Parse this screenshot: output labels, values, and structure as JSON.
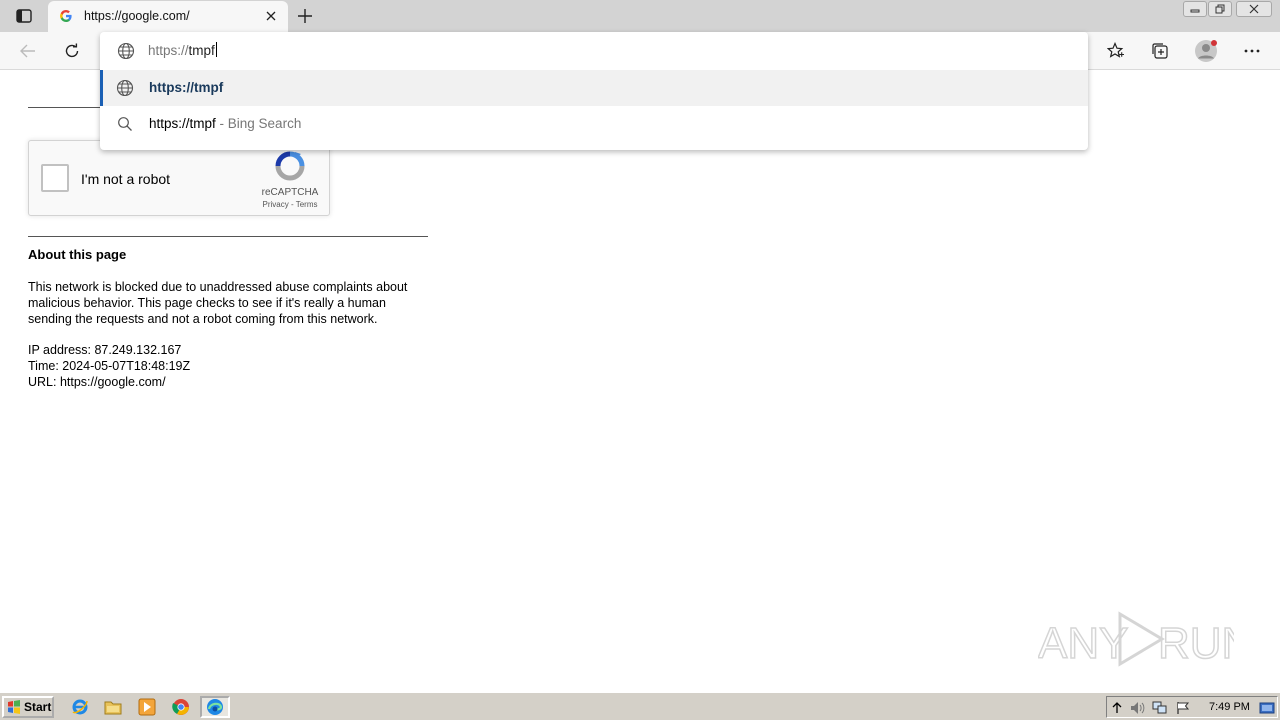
{
  "browser": {
    "tab": {
      "title": "https://google.com/"
    },
    "omnibox": {
      "typed_prefix": "https://",
      "typed_suffix": "tmpf",
      "suggestions": [
        {
          "label": "https://tmpf",
          "icon": "globe-icon"
        },
        {
          "label": "https://tmpf",
          "suffix": " - Bing Search",
          "icon": "search-icon"
        }
      ]
    }
  },
  "page": {
    "recaptcha": {
      "checkbox_label": "I'm not a robot",
      "brand": "reCAPTCHA",
      "links": "Privacy - Terms"
    },
    "about": {
      "heading": "About this page",
      "text": "This network is blocked due to unaddressed abuse complaints about malicious behavior. This page checks to see if it's really a human sending the requests and not a robot coming from this network.",
      "ip_line": "IP address: 87.249.132.167",
      "time_line": "Time: 2024-05-07T18:48:19Z",
      "url_line": "URL: https://google.com/"
    }
  },
  "watermark": "ANY RUN",
  "taskbar": {
    "start_label": "Start",
    "clock": "7:49 PM",
    "apps": [
      "ie-icon",
      "folder-icon",
      "media-player-icon",
      "chrome-icon",
      "edge-icon"
    ]
  },
  "colors": {
    "selected_accent": "#1a5fb4",
    "taskbar": "#d4d0c8"
  }
}
